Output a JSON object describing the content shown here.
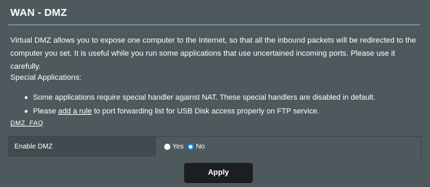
{
  "title": "WAN - DMZ",
  "description": "Virtual DMZ allows you to expose one computer to the Internet, so that all the inbound packets will be redirected to the computer you set. It is useful while you run some applications that use uncertained incoming ports. Please use it carefully.",
  "special_applications": {
    "heading": "Special Applications:",
    "bullet1": "Some applications require special handler against NAT. These special handlers are disabled in default.",
    "bullet2_before": "Please ",
    "bullet2_link": "add a rule",
    "bullet2_after": " to port forwarding list for USB Disk access properly on FTP service."
  },
  "faq_link": "DMZ  FAQ",
  "enable_dmz": {
    "label": "Enable DMZ",
    "options": [
      "Yes",
      "No"
    ],
    "selected": "No"
  },
  "apply_label": "Apply",
  "colors": {
    "background": "#4d595d",
    "button": "#1b1f21",
    "radio_selected": "#1e90ff"
  }
}
